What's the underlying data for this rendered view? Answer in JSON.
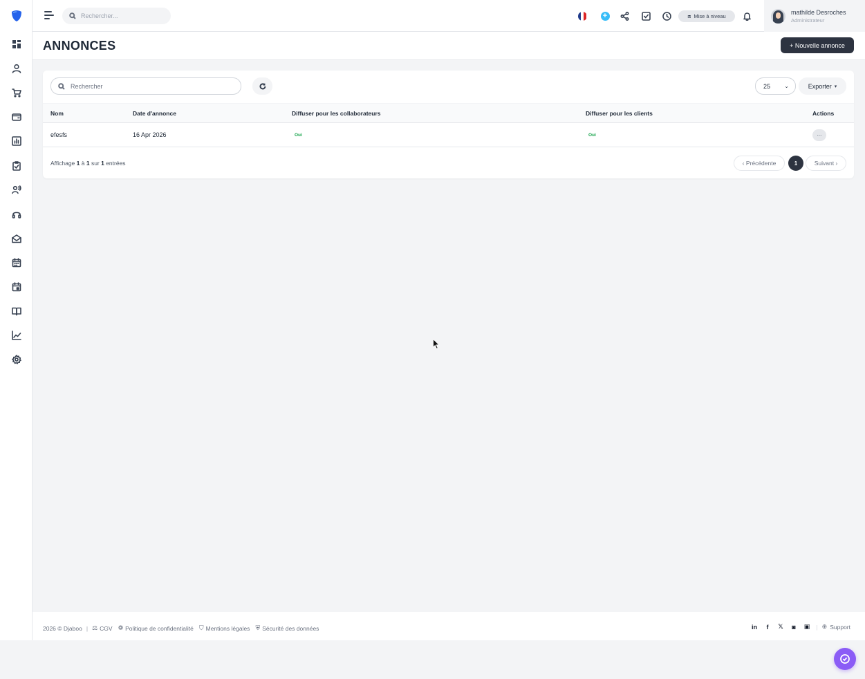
{
  "colors": {
    "brand": "#2563eb",
    "primary_button": "#2d3340",
    "success": "#16a34a",
    "chat": "#8b5cf6",
    "info_icon": "#38bdf8"
  },
  "sidebar": {
    "items": [
      {
        "name": "dashboard",
        "icon": "grid-icon"
      },
      {
        "name": "users",
        "icon": "user-icon"
      },
      {
        "name": "shop",
        "icon": "cart-icon"
      },
      {
        "name": "wallet",
        "icon": "wallet-icon"
      },
      {
        "name": "stats",
        "icon": "bar-chart-icon"
      },
      {
        "name": "tasks",
        "icon": "clipboard-check-icon"
      },
      {
        "name": "team",
        "icon": "users-signal-icon"
      },
      {
        "name": "support",
        "icon": "headset-icon"
      },
      {
        "name": "mail",
        "icon": "mail-open-icon"
      },
      {
        "name": "calendar",
        "icon": "calendar-icon"
      },
      {
        "name": "events",
        "icon": "calendar-dot-icon"
      },
      {
        "name": "docs",
        "icon": "book-icon"
      },
      {
        "name": "analytics",
        "icon": "line-chart-icon"
      },
      {
        "name": "settings",
        "icon": "gear-icon"
      }
    ]
  },
  "topbar": {
    "search_placeholder": "Rechercher...",
    "upgrade_label": "Mise à niveau",
    "user": {
      "name": "mathilde Desroches",
      "role": "Administrateur"
    }
  },
  "page": {
    "title": "ANNONCES",
    "new_button": "+ Nouvelle annonce"
  },
  "table": {
    "search_placeholder": "Rechercher",
    "per_page": "25",
    "export_label": "Exporter",
    "columns": {
      "name": "Nom",
      "date": "Date d'annonce",
      "collab": "Diffuser pour les collaborateurs",
      "clients": "Diffuser pour les clients",
      "actions": "Actions"
    },
    "rows": [
      {
        "name": "efesfs",
        "date": "16 Apr 2026",
        "collab": "Oui",
        "clients": "Oui",
        "action": "..."
      }
    ],
    "info": {
      "prefix": "Affichage ",
      "from": "1",
      "mid1": " à ",
      "to": "1",
      "mid2": " sur ",
      "total": "1",
      "suffix": " entrées"
    },
    "pagination": {
      "prev": "‹ Précédente",
      "current": "1",
      "next": "Suivant ›"
    }
  },
  "footer": {
    "copyright": "2026 © Djaboo",
    "links": [
      {
        "label": "CGV",
        "icon": "scale-icon"
      },
      {
        "label": "Politique de confidentialité",
        "icon": "cookie-icon"
      },
      {
        "label": "Mentions légales",
        "icon": "shield-icon"
      },
      {
        "label": "Sécurité des données",
        "icon": "shield-lock-icon"
      }
    ],
    "social": [
      "linkedin-icon",
      "facebook-icon",
      "x-icon",
      "instagram-icon",
      "youtube-icon"
    ],
    "support_label": "Support"
  }
}
